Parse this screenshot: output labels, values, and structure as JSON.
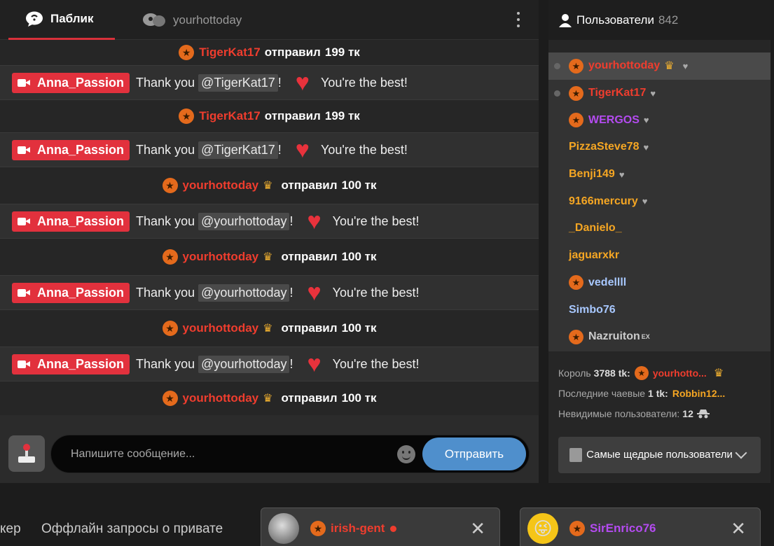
{
  "chat": {
    "tabs": [
      {
        "label": "Паблик"
      },
      {
        "label": "yourhottoday"
      }
    ],
    "messages": [
      {
        "type": "tip",
        "user": "TigerKat17",
        "color": "red",
        "crown": false,
        "text": "отправил",
        "amount": "199 тк"
      },
      {
        "type": "msg",
        "model": "Anna_Passion",
        "pre": "Thank you",
        "mention": "@TigerKat17",
        "excl": "!",
        "post": "You're the best!"
      },
      {
        "type": "tip",
        "user": "TigerKat17",
        "color": "red",
        "crown": false,
        "text": "отправил",
        "amount": "199 тк"
      },
      {
        "type": "msg",
        "model": "Anna_Passion",
        "pre": "Thank you",
        "mention": "@TigerKat17",
        "excl": "!",
        "post": "You're the best!"
      },
      {
        "type": "tip",
        "user": "yourhottoday",
        "color": "red",
        "crown": true,
        "text": "отправил",
        "amount": "100 тк"
      },
      {
        "type": "msg",
        "model": "Anna_Passion",
        "pre": "Thank you",
        "mention": "@yourhottoday",
        "excl": "!",
        "post": "You're the best!"
      },
      {
        "type": "tip",
        "user": "yourhottoday",
        "color": "red",
        "crown": true,
        "text": "отправил",
        "amount": "100 тк"
      },
      {
        "type": "msg",
        "model": "Anna_Passion",
        "pre": "Thank you",
        "mention": "@yourhottoday",
        "excl": "!",
        "post": "You're the best!"
      },
      {
        "type": "tip",
        "user": "yourhottoday",
        "color": "red",
        "crown": true,
        "text": "отправил",
        "amount": "100 тк"
      },
      {
        "type": "msg",
        "model": "Anna_Passion",
        "pre": "Thank you",
        "mention": "@yourhottoday",
        "excl": "!",
        "post": "You're the best!"
      },
      {
        "type": "tip",
        "user": "yourhottoday",
        "color": "red",
        "crown": true,
        "text": "отправил",
        "amount": "100 тк"
      }
    ],
    "input": {
      "placeholder": "Напишите сообщение...",
      "send_label": "Отправить"
    }
  },
  "users": {
    "title": "Пользователи",
    "count": "842",
    "list": [
      {
        "name": "yourhottoday",
        "style": "red",
        "star": true,
        "crown": true,
        "heart": true,
        "dot": true,
        "selected": true
      },
      {
        "name": "TigerKat17",
        "style": "red",
        "star": true,
        "crown": false,
        "heart": true,
        "dot": true,
        "selected": false
      },
      {
        "name": "WERGOS",
        "style": "purple",
        "star": true,
        "crown": false,
        "heart": true,
        "dot": false,
        "selected": false
      },
      {
        "name": "PizzaSteve78",
        "style": "orange",
        "star": false,
        "crown": false,
        "heart": true,
        "dot": false,
        "selected": false
      },
      {
        "name": "Benji149",
        "style": "orange",
        "star": false,
        "crown": false,
        "heart": true,
        "dot": false,
        "selected": false
      },
      {
        "name": "9166mercury",
        "style": "orange",
        "star": false,
        "crown": false,
        "heart": true,
        "dot": false,
        "selected": false
      },
      {
        "name": "_Danielo_",
        "style": "orange",
        "star": false,
        "crown": false,
        "heart": false,
        "dot": false,
        "selected": false
      },
      {
        "name": "jaguarxkr",
        "style": "orange",
        "star": false,
        "crown": false,
        "heart": false,
        "dot": false,
        "selected": false
      },
      {
        "name": "vedellll",
        "style": "blue",
        "star": true,
        "crown": false,
        "heart": false,
        "dot": false,
        "selected": false
      },
      {
        "name": "Simbo76",
        "style": "blue",
        "star": false,
        "crown": false,
        "heart": false,
        "dot": false,
        "selected": false
      },
      {
        "name": "Nazruiton",
        "style": "gray",
        "star": true,
        "crown": false,
        "heart": false,
        "dot": false,
        "selected": false,
        "sup": "EX"
      }
    ],
    "king": {
      "label": "Король",
      "amount": "3788 tk:",
      "name": "yourhotto..."
    },
    "last_tip": {
      "label": "Последние чаевые",
      "amount": "1 tk:",
      "name": "Robbin12..."
    },
    "invisible": {
      "label": "Невидимые пользователи:",
      "count": "12"
    },
    "top_label": "Самые щедрые пользователи"
  },
  "bottom": {
    "left_text1": "кер",
    "left_text2": "Оффлайн запросы о привате",
    "pm1": {
      "name": "irish-gent"
    },
    "pm2": {
      "name": "SirEnrico76"
    }
  }
}
